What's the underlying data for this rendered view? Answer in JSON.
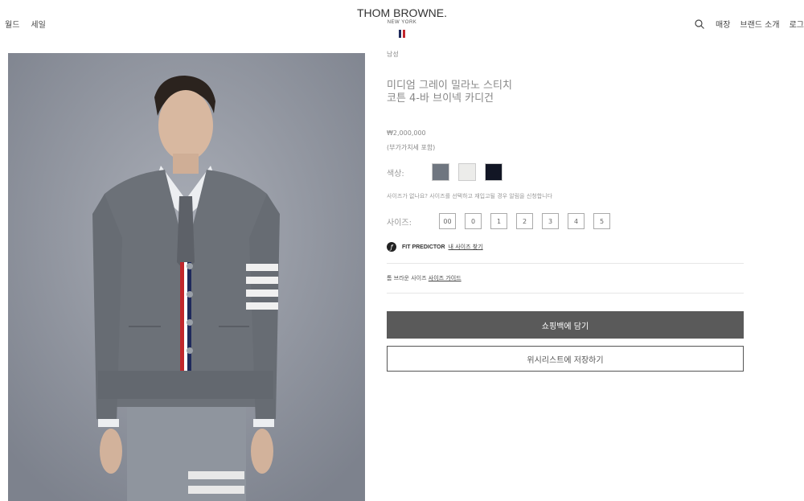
{
  "header": {
    "nav_left": [
      "월드",
      "세일"
    ],
    "logo_main": "THOM BROWNE.",
    "logo_sub": "NEW YORK",
    "nav_right": [
      "매장",
      "브랜드 소개",
      "로그"
    ],
    "search_icon": "search-icon",
    "flag_colors": [
      "#1f2a5c",
      "#ffffff",
      "#c1272d"
    ]
  },
  "product": {
    "category": "남성",
    "title_line1": "미디엄 그레이 밀라노 스티치",
    "title_line2": "코튼 4-바 브이넥 카디건",
    "price": "₩2,000,000",
    "vat": "(부가가치세 포함)",
    "color_label": "색상:",
    "colors": [
      "#6f7680",
      "#ececea",
      "#121625"
    ],
    "size_note": "사이즈가 없나요? 사이즈를 선택하고 재입고될 경우 알림을 신청합니다",
    "size_label": "사이즈:",
    "sizes": [
      "00",
      "0",
      "1",
      "2",
      "3",
      "4",
      "5"
    ],
    "fit_title": "FIT PREDICTOR",
    "fit_link": "내 사이즈 찾기",
    "guide_prefix": "톰 브라운 사이즈",
    "guide_link": "사이즈 가이드",
    "cart_button": "쇼핑백에 담기",
    "wishlist_button": "위시리스트에 저장하기"
  }
}
